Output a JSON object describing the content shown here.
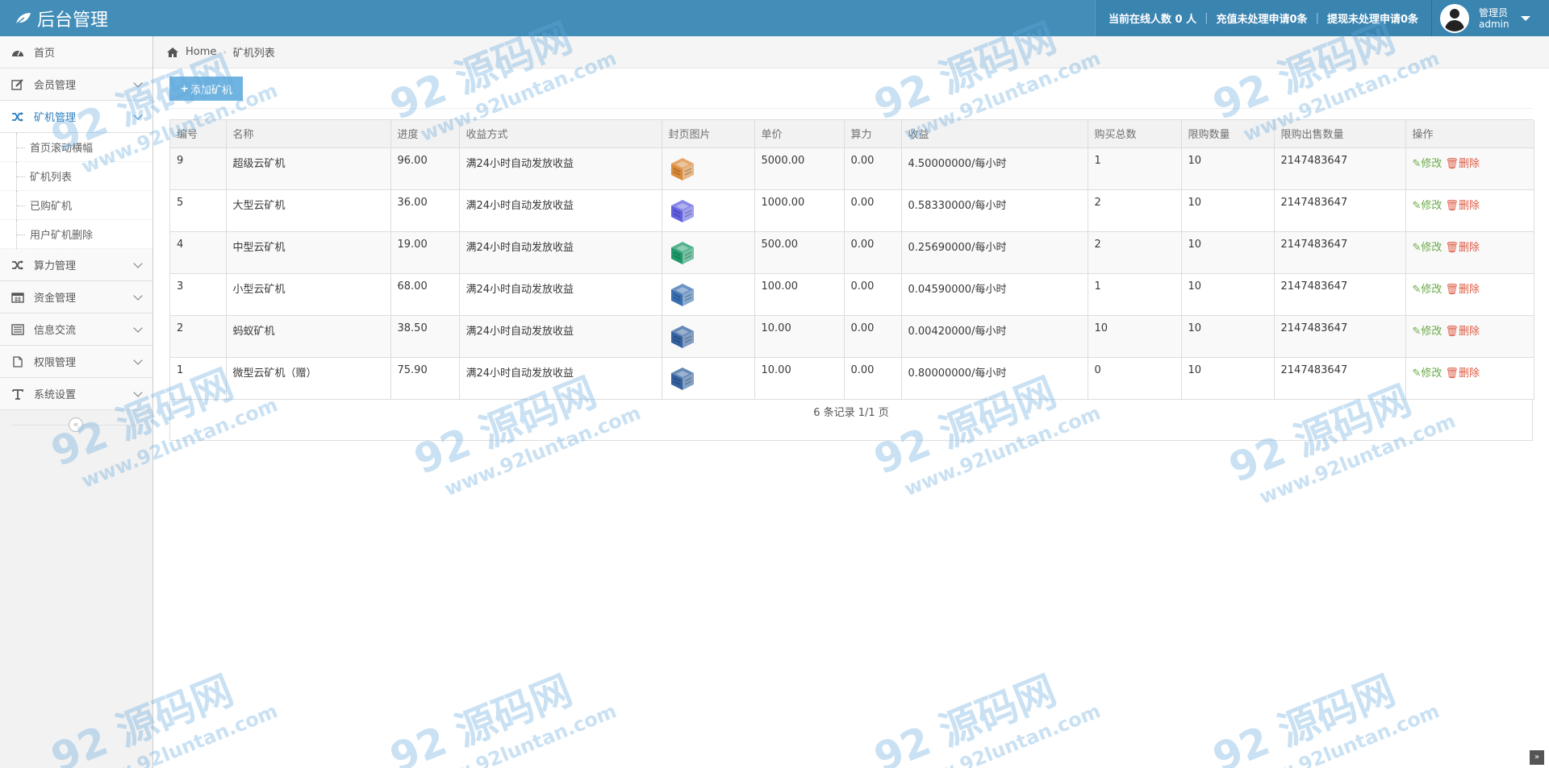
{
  "navbar": {
    "brand": "后台管理",
    "online": "当前在线人数 0 人",
    "recharge": "充值未处理申请0条",
    "withdraw": "提现未处理申请0条",
    "user_role": "管理员",
    "user_name": "admin"
  },
  "sidebar": {
    "items": [
      {
        "label": "首页",
        "icon": "dashboard-icon"
      },
      {
        "label": "会员管理",
        "icon": "edit-icon"
      },
      {
        "label": "矿机管理",
        "icon": "shuffle-icon"
      },
      {
        "label": "算力管理",
        "icon": "shuffle-icon"
      },
      {
        "label": "资金管理",
        "icon": "calendar-icon"
      },
      {
        "label": "信息交流",
        "icon": "list-icon"
      },
      {
        "label": "权限管理",
        "icon": "file-icon"
      },
      {
        "label": "系统设置",
        "icon": "text-icon"
      }
    ],
    "sub_items": [
      "首页滚动横幅",
      "矿机列表",
      "已购矿机",
      "用户矿机删除"
    ]
  },
  "breadcrumb": {
    "home": "Home",
    "current": "矿机列表"
  },
  "toolbar": {
    "add_label": "添加矿机"
  },
  "table": {
    "headers": [
      "编号",
      "名称",
      "进度",
      "收益方式",
      "封页图片",
      "单价",
      "算力",
      "收益",
      "购买总数",
      "限购数量",
      "限购出售数量",
      "操作"
    ],
    "rows": [
      {
        "id": "9",
        "name": "超级云矿机",
        "progress": "96.00",
        "mode": "满24小时自动发放收益",
        "color": "#d98a3a",
        "price": "5000.00",
        "power": "0.00",
        "income": "4.50000000/每小时",
        "total": "1",
        "limit": "10",
        "limit_sale": "2147483647"
      },
      {
        "id": "5",
        "name": "大型云矿机",
        "progress": "36.00",
        "mode": "满24小时自动发放收益",
        "color": "#6060e0",
        "price": "1000.00",
        "power": "0.00",
        "income": "0.58330000/每小时",
        "total": "2",
        "limit": "10",
        "limit_sale": "2147483647"
      },
      {
        "id": "4",
        "name": "中型云矿机",
        "progress": "19.00",
        "mode": "满24小时自动发放收益",
        "color": "#1e9a6a",
        "price": "500.00",
        "power": "0.00",
        "income": "0.25690000/每小时",
        "total": "2",
        "limit": "10",
        "limit_sale": "2147483647"
      },
      {
        "id": "3",
        "name": "小型云矿机",
        "progress": "68.00",
        "mode": "满24小时自动发放收益",
        "color": "#3a6fb0",
        "price": "100.00",
        "power": "0.00",
        "income": "0.04590000/每小时",
        "total": "1",
        "limit": "10",
        "limit_sale": "2147483647"
      },
      {
        "id": "2",
        "name": "蚂蚁矿机",
        "progress": "38.50",
        "mode": "满24小时自动发放收益",
        "color": "#34619e",
        "price": "10.00",
        "power": "0.00",
        "income": "0.00420000/每小时",
        "total": "10",
        "limit": "10",
        "limit_sale": "2147483647"
      },
      {
        "id": "1",
        "name": "微型云矿机（赠）",
        "progress": "75.90",
        "mode": "满24小时自动发放收益",
        "color": "#34619e",
        "price": "10.00",
        "power": "0.00",
        "income": "0.80000000/每小时",
        "total": "0",
        "limit": "10",
        "limit_sale": "2147483647"
      }
    ],
    "edit_label": "修改",
    "delete_label": "删除",
    "pager": "6 条记录 1/1 页"
  },
  "watermark": {
    "main": "92 源码网",
    "sub": "www.92luntan.com"
  },
  "colors": {
    "navbar": "#438eb9",
    "accent": "#2b7dbc",
    "add_button": "#6fb3e0",
    "edit": "#69aa46",
    "delete": "#dd5a43"
  }
}
